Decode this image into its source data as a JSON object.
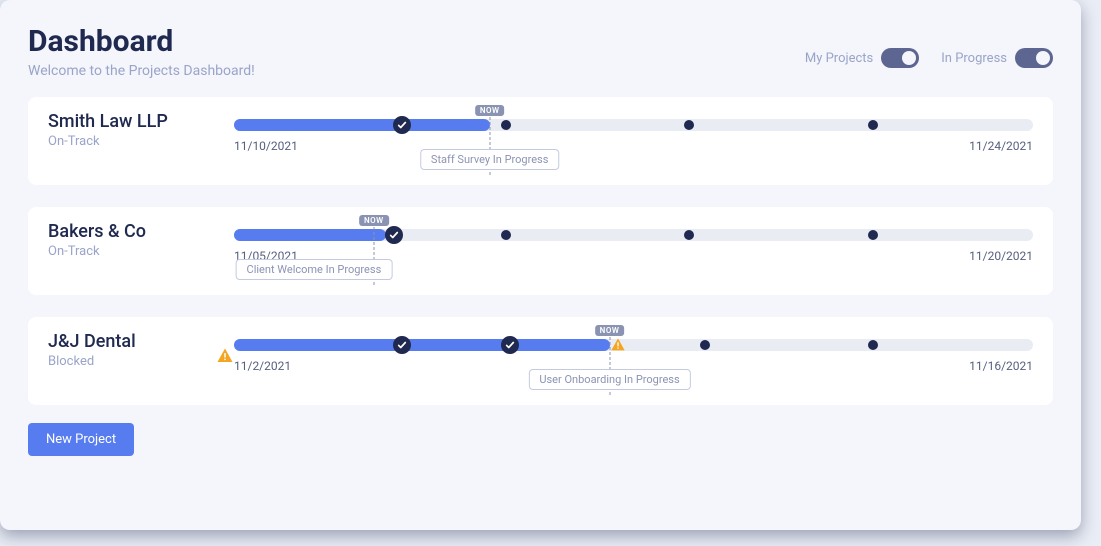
{
  "header": {
    "title": "Dashboard",
    "subtitle": "Welcome to the Projects Dashboard!"
  },
  "toggles": {
    "my_projects": {
      "label": "My Projects",
      "on": true
    },
    "in_progress": {
      "label": "In Progress",
      "on": true
    }
  },
  "now_label": "NOW",
  "projects": [
    {
      "name": "Smith Law LLP",
      "status": "On-Track",
      "blocked": false,
      "start_date": "11/10/2021",
      "end_date": "11/24/2021",
      "fill_percent": 32,
      "now_percent": 32,
      "done_markers": [
        21
      ],
      "warn_markers": [],
      "milestones": [
        34,
        57,
        80
      ],
      "current_task": "Staff Survey In Progress",
      "task_anchor_percent": 32
    },
    {
      "name": "Bakers & Co",
      "status": "On-Track",
      "blocked": false,
      "start_date": "11/05/2021",
      "end_date": "11/20/2021",
      "fill_percent": 19,
      "now_percent": 17.5,
      "done_markers": [
        20
      ],
      "warn_markers": [],
      "milestones": [
        34,
        57,
        80
      ],
      "current_task": "Client Welcome In Progress",
      "task_anchor_percent": 10
    },
    {
      "name": "J&J Dental",
      "status": "Blocked",
      "blocked": true,
      "start_date": "11/2/2021",
      "end_date": "11/16/2021",
      "fill_percent": 47,
      "now_percent": 47,
      "done_markers": [
        21,
        34.5
      ],
      "warn_markers": [
        48
      ],
      "milestones": [
        59,
        80
      ],
      "current_task": "User Onboarding In Progress",
      "task_anchor_percent": 47
    }
  ],
  "buttons": {
    "new_project": "New Project"
  }
}
